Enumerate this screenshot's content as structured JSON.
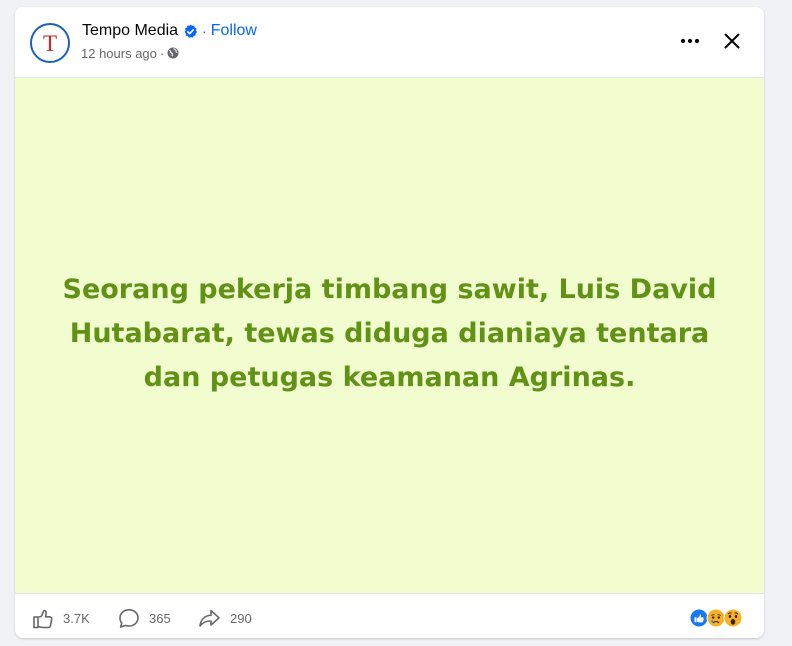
{
  "post": {
    "page_name": "Tempo Media",
    "avatar_letter": "T",
    "follow_label": "Follow",
    "dot": "·",
    "timestamp": "12 hours ago",
    "meta_sep": "·",
    "visibility_icon": "globe-icon",
    "text": "Seorang pekerja timbang sawit, Luis David Hutabarat, tewas diduga dianiaya tentara dan petugas keamanan Agrinas.",
    "background_color": "#f1fccf",
    "text_color": "#619115"
  },
  "header_actions": {
    "more_icon": "more-horizontal-icon",
    "close_icon": "close-icon"
  },
  "footer": {
    "likes": "3.7K",
    "comments": "365",
    "shares": "290",
    "reaction_icons": [
      "like-reaction-icon",
      "sad-reaction-icon",
      "wow-reaction-icon"
    ]
  },
  "colors": {
    "accent": "#0866ff",
    "muted": "#65676b",
    "avatar_border": "#1c5fbf",
    "avatar_letter": "#c8262b"
  }
}
